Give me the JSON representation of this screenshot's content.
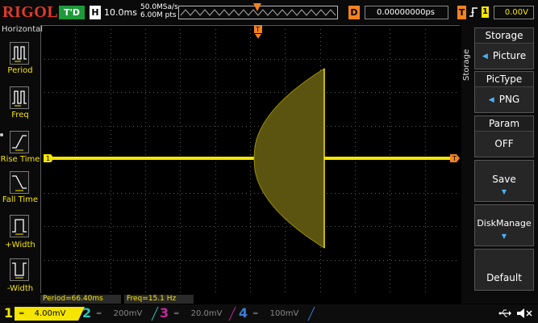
{
  "topbar": {
    "logo": "RIGOL",
    "run_state": "T'D",
    "h_label": "H",
    "timebase": "10.0ms",
    "sample_rate": "50.0MSa/s",
    "memory_depth": "6.00M pts",
    "d_label": "D",
    "delay": "0.00000000ps",
    "t_label": "T",
    "trigger_source": "1",
    "trigger_level": "0.00V"
  },
  "left_menu": {
    "title": "Horizontal",
    "items": [
      {
        "label": "Period",
        "icon": "period-icon"
      },
      {
        "label": "Freq",
        "icon": "freq-icon"
      },
      {
        "label": "Rise Time",
        "icon": "rise-time-icon"
      },
      {
        "label": "Fall Time",
        "icon": "fall-time-icon"
      },
      {
        "label": "+Width",
        "icon": "pos-width-icon"
      },
      {
        "label": "-Width",
        "icon": "neg-width-icon"
      }
    ]
  },
  "right_menu": {
    "tab_label": "Storage",
    "title": "Storage",
    "storage_value": "Picture",
    "pictype_label": "PicType",
    "pictype_value": "PNG",
    "param_label": "Param",
    "param_value": "OFF",
    "save_label": "Save",
    "diskmanage_label": "DiskManage",
    "default_label": "Default"
  },
  "markers": {
    "ch1_marker": "1",
    "trigger_top_marker": "T"
  },
  "measurements": {
    "period": "Period=66.40ms",
    "freq": "Freq=15.1 Hz"
  },
  "channels": [
    {
      "num": "1",
      "scale": "4.00mV",
      "color": "#f5e500",
      "active": true
    },
    {
      "num": "2",
      "scale": "200mV",
      "color": "#2ec4b6",
      "active": false
    },
    {
      "num": "3",
      "scale": "20.0mV",
      "color": "#c2289a",
      "active": false
    },
    {
      "num": "4",
      "scale": "100mV",
      "color": "#3a7dd8",
      "active": false
    }
  ],
  "status_icons": [
    "usb-icon",
    "speaker-icon"
  ],
  "colors": {
    "ch1": "#f5e500",
    "trigger": "#f5821f",
    "menu_accent": "#4ab2ff",
    "logo": "#e23a2a",
    "run_state": "#1d9a39"
  }
}
